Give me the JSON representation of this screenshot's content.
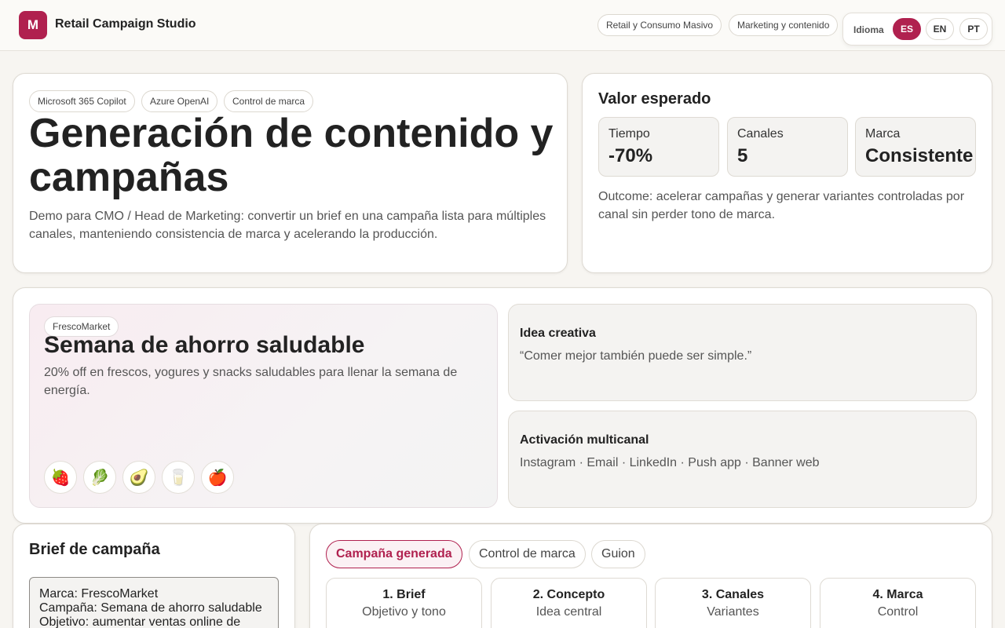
{
  "app": {
    "logo_letter": "M",
    "title": "Retail Campaign Studio"
  },
  "header": {
    "chips": [
      "Retail y Consumo Masivo",
      "Marketing y contenido"
    ],
    "language": {
      "label": "Idioma",
      "options": [
        "ES",
        "EN",
        "PT"
      ],
      "selected": "ES"
    }
  },
  "hero": {
    "tags": [
      "Microsoft 365 Copilot",
      "Azure OpenAI",
      "Control de marca"
    ],
    "title": "Generación de contenido y campañas",
    "description": "Demo para CMO / Head de Marketing: convertir un brief en una campaña lista para múltiples canales, manteniendo consistencia de marca y acelerando la producción."
  },
  "value": {
    "title": "Valor esperado",
    "metrics": [
      {
        "label": "Tiempo",
        "value": "-70%"
      },
      {
        "label": "Canales",
        "value": "5"
      },
      {
        "label": "Marca",
        "value": "Consistente"
      }
    ],
    "outcome": "Outcome: acelerar campañas y generar variantes controladas por canal sin perder tono de marca."
  },
  "campaign": {
    "brand": "FrescoMarket",
    "title": "Semana de ahorro saludable",
    "description": "20% off en frescos, yogures y snacks saludables para llenar la semana de energía.",
    "products": [
      {
        "icon": "strawberry-icon",
        "glyph": "🍓"
      },
      {
        "icon": "lettuce-icon",
        "glyph": "🥬"
      },
      {
        "icon": "avocado-icon",
        "glyph": "🥑"
      },
      {
        "icon": "milk-glass-icon",
        "glyph": "🥛"
      },
      {
        "icon": "apple-icon",
        "glyph": "🍎"
      }
    ],
    "idea": {
      "title": "Idea creativa",
      "text": "“Comer mejor también puede ser simple.”"
    },
    "activation": {
      "title": "Activación multicanal",
      "text": "Instagram · Email · LinkedIn · Push app · Banner web"
    }
  },
  "brief": {
    "title": "Brief de campaña",
    "lines": [
      "Marca: FrescoMarket",
      "Campaña: Semana de ahorro saludable",
      "Objetivo: aumentar ventas online de"
    ]
  },
  "output": {
    "tabs": [
      "Campaña generada",
      "Control de marca",
      "Guion"
    ],
    "active_tab": "Campaña generada",
    "steps": [
      {
        "title": "1. Brief",
        "subtitle": "Objetivo y tono"
      },
      {
        "title": "2. Concepto",
        "subtitle": "Idea central"
      },
      {
        "title": "3. Canales",
        "subtitle": "Variantes"
      },
      {
        "title": "4. Marca",
        "subtitle": "Control"
      }
    ]
  },
  "colors": {
    "accent": "#b0214f",
    "background": "#f7f5f1",
    "card": "#ffffff"
  }
}
